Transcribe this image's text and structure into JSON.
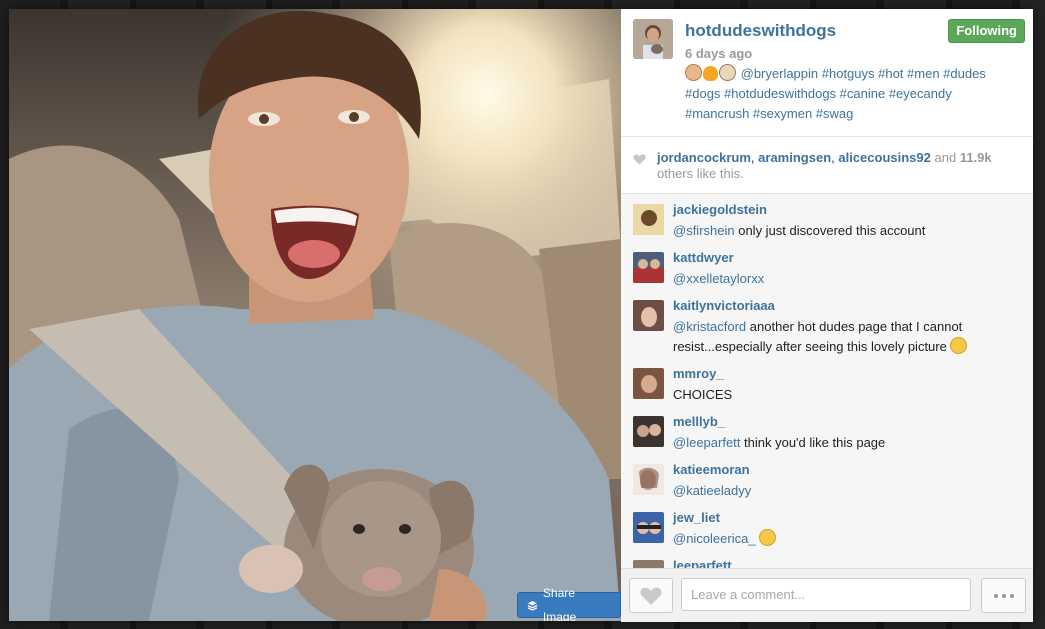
{
  "post": {
    "username": "hotdudeswithdogs",
    "follow_label": "Following",
    "time_ago": "6 days ago",
    "caption_emojis": [
      "man-face-emoji",
      "fire-emoji",
      "dog-face-emoji"
    ],
    "caption": "@bryerlappin #hotguys #hot #men #dudes #dogs #hotdudeswithdogs #canine #eyecandy #mancrush #sexymen #swag",
    "share_label": "Share Image"
  },
  "likes": {
    "users": [
      "jordancockrum",
      "aramingsen",
      "alicecousins92"
    ],
    "and_text": "and",
    "count": "11.9k",
    "others_text": "others like this."
  },
  "comments": [
    {
      "user": "jackiegoldstein",
      "mention": "@sfirshein",
      "text": " only just discovered this account",
      "avatar_color": "#8a6a3a"
    },
    {
      "user": "kattdwyer",
      "mention": "@xxelletaylorxx",
      "text": "",
      "avatar_color": "#4f5e78"
    },
    {
      "user": "kaitlynvictoriaaa",
      "mention": "@kristacford",
      "text": " another hot dudes page that I cannot resist...especially after seeing this lovely picture",
      "emoji": "heart-eyes-emoji",
      "avatar_color": "#6e4e44"
    },
    {
      "user": "mmroy_",
      "mention": "",
      "text": "CHOICES",
      "avatar_color": "#7a5540"
    },
    {
      "user": "melllyb_",
      "mention": "@leeparfett",
      "text": " think you'd like this page",
      "avatar_color": "#3c3330"
    },
    {
      "user": "katieemoran",
      "mention": "@katieeladyy",
      "text": "",
      "avatar_color": "#c49a8a"
    },
    {
      "user": "jew_liet",
      "mention": "@nicoleerica_",
      "text": "",
      "emoji": "heart-eyes-emoji",
      "avatar_color": "#3d63a8"
    },
    {
      "user": "leeparfett",
      "mention": "",
      "text": "",
      "avatar_color": "#8b7a6a"
    }
  ],
  "footer": {
    "comment_placeholder": "Leave a comment..."
  },
  "colors": {
    "link": "#3f729b",
    "follow_green": "#5ca75a",
    "share_blue": "#3a7bc0"
  }
}
